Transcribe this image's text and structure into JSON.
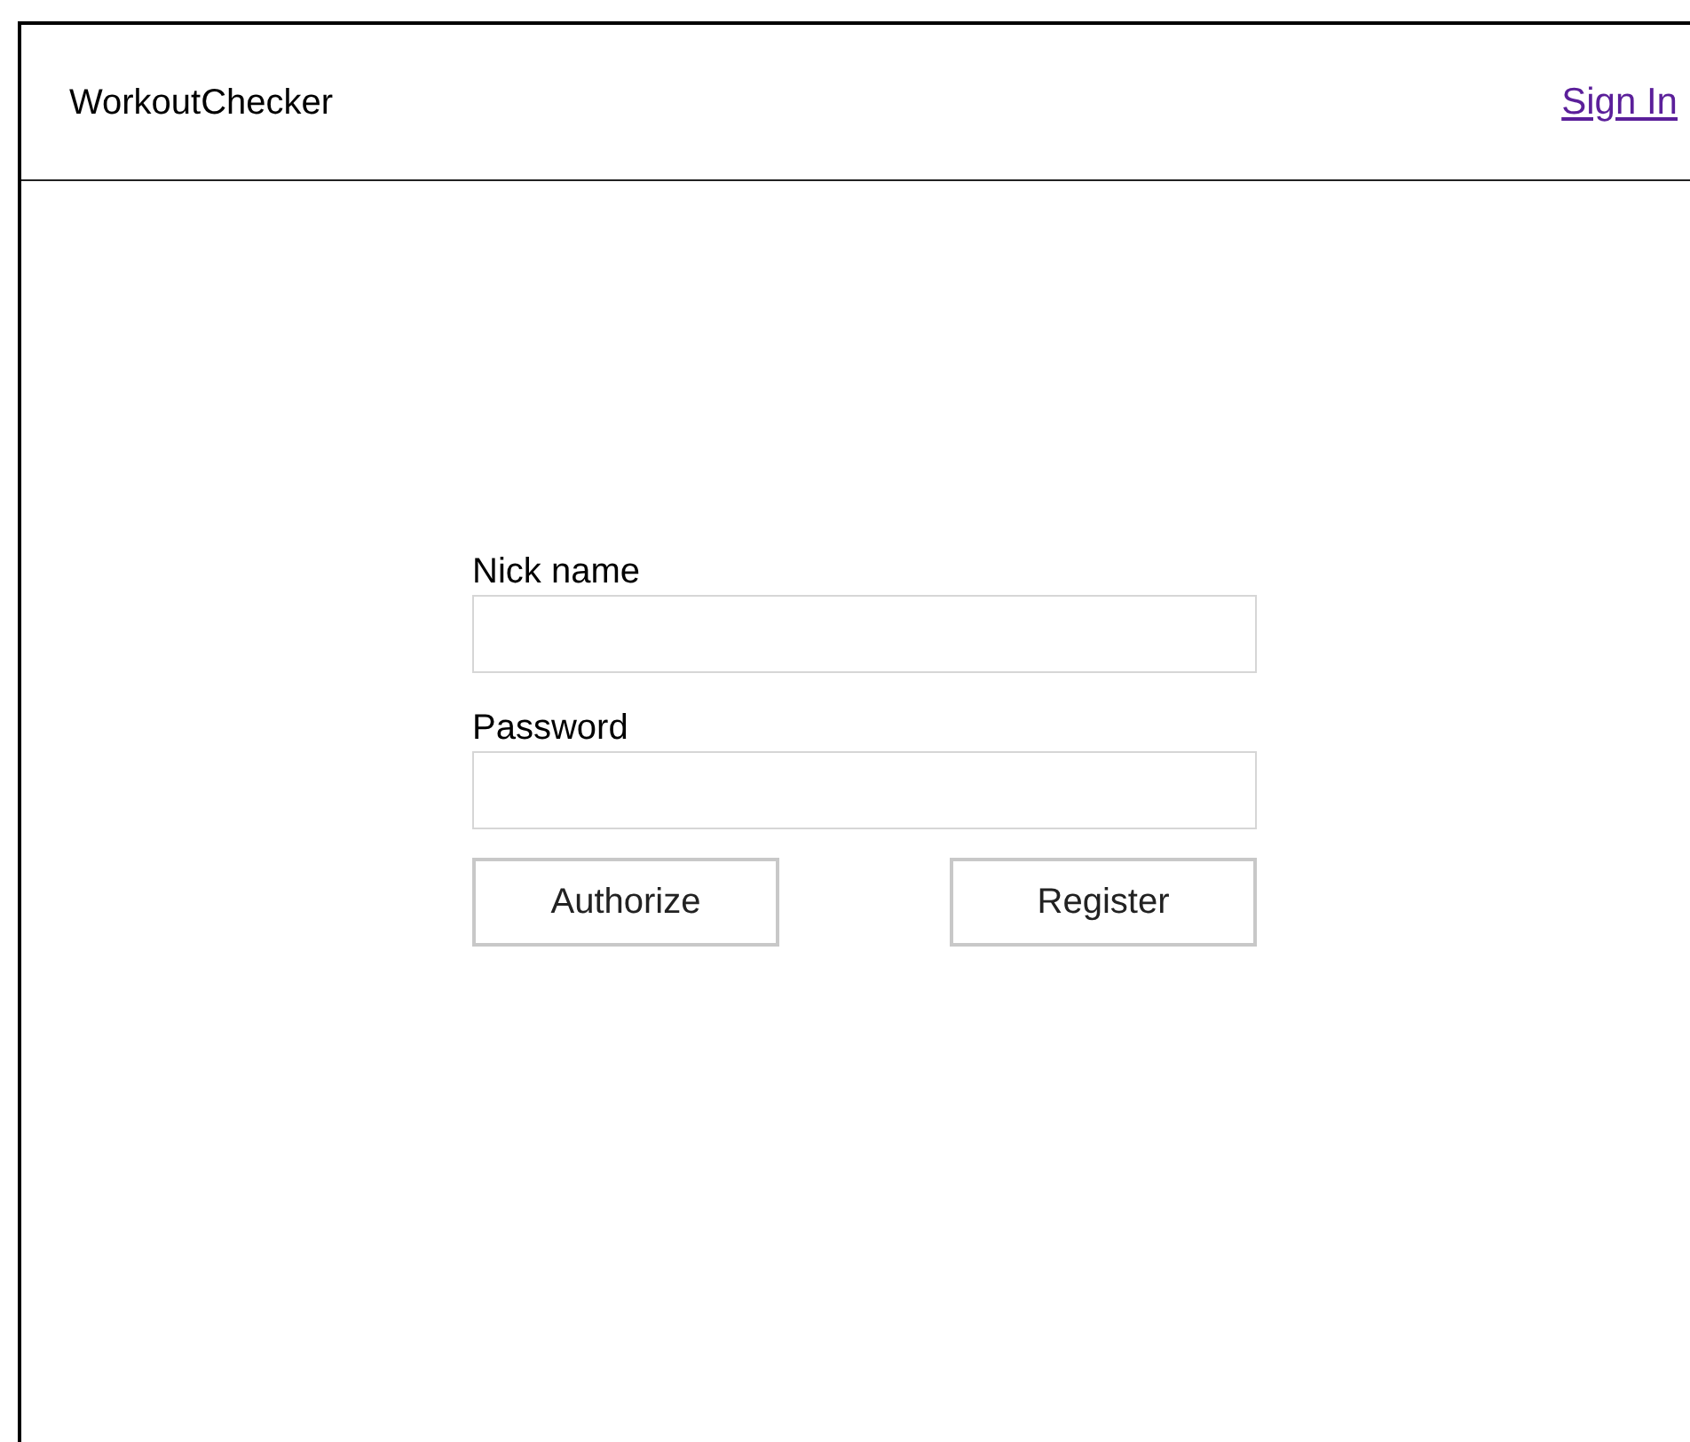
{
  "header": {
    "brand": "WorkoutChecker",
    "sign_in_link": "Sign In"
  },
  "form": {
    "fields": [
      {
        "label": "Nick name"
      },
      {
        "label": "Password"
      }
    ],
    "buttons": [
      "Authorize",
      "Register"
    ]
  }
}
